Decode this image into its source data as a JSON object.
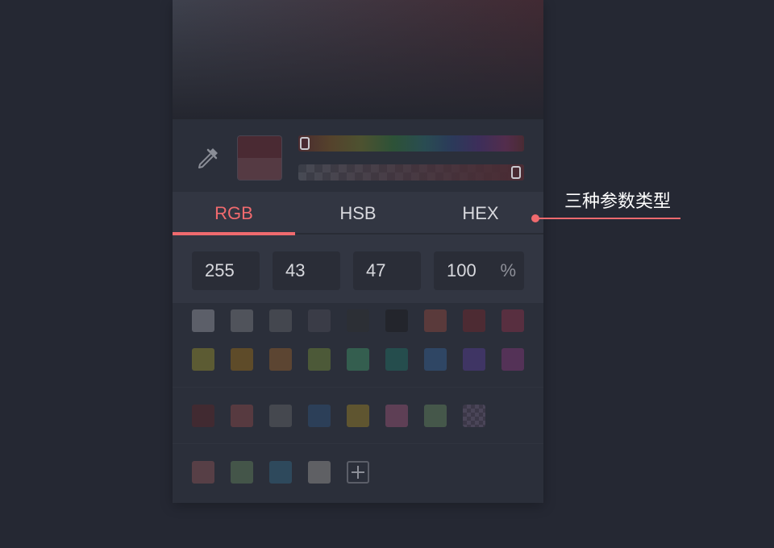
{
  "picker": {
    "current_color": "#4a2b33",
    "tabs": [
      {
        "label": "RGB",
        "active": true
      },
      {
        "label": "HSB",
        "active": false
      },
      {
        "label": "HEX",
        "active": false
      }
    ],
    "fields": {
      "r": "255",
      "g": "43",
      "b": "47",
      "alpha": "100",
      "alpha_unit": "%"
    }
  },
  "palette": {
    "row1": [
      "#5c5f69",
      "#50535b",
      "#44474f",
      "#3a3c47",
      "#2c2f35",
      "#23252c",
      "#5a3a3b",
      "#4d2b33",
      "#582f40"
    ],
    "row2": [
      "#5c5b33",
      "#5e4b29",
      "#5c4532",
      "#4c5938",
      "#345e4f",
      "#254d4d",
      "#2f4664",
      "#3f3564",
      "#543257"
    ],
    "recent": [
      "#412a31",
      "#573a40",
      "#45484f",
      "#2c3f58",
      "#5f5530",
      "#5e3f55",
      "#45574a",
      "checker"
    ],
    "custom": [
      "#573f46",
      "#445549",
      "#2e495c",
      "#5f6064"
    ]
  },
  "annotation": {
    "text": "三种参数类型",
    "color": "#f06a6e"
  }
}
